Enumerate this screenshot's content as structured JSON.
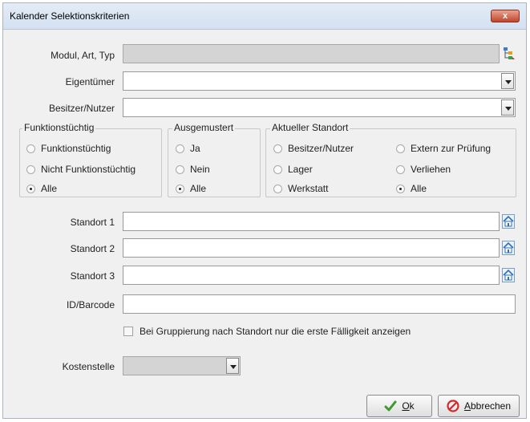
{
  "window": {
    "title": "Kalender Selektionskriterien",
    "close_glyph": "x"
  },
  "fields": {
    "modul_label": "Modul, Art, Typ",
    "eigentuemer_label": "Eigentümer",
    "besitzer_label": "Besitzer/Nutzer",
    "standort1_label": "Standort 1",
    "standort2_label": "Standort 2",
    "standort3_label": "Standort 3",
    "barcode_label": "ID/Barcode",
    "kostenstelle_label": "Kostenstelle"
  },
  "groups": {
    "funktion": {
      "title": "Funktionstüchtig",
      "options": [
        "Funktionstüchtig",
        "Nicht Funktionstüchtig",
        "Alle"
      ],
      "selected": "Alle"
    },
    "ausgemustert": {
      "title": "Ausgemustert",
      "options": [
        "Ja",
        "Nein",
        "Alle"
      ],
      "selected": "Alle"
    },
    "standort": {
      "title": "Aktueller Standort",
      "options": [
        "Besitzer/Nutzer",
        "Lager",
        "Werkstatt",
        "Extern zur Prüfung",
        "Verliehen",
        "Alle"
      ],
      "selected": "Alle"
    }
  },
  "checkbox": {
    "label": "Bei Gruppierung nach Standort nur die erste Fälligkeit anzeigen",
    "checked": false
  },
  "buttons": {
    "ok_underlined": "O",
    "ok_rest": "k",
    "cancel_underlined": "A",
    "cancel_rest": "bbrechen"
  },
  "icons": {
    "modul": "tree-select-icon",
    "standort": "house-icon",
    "ok": "checkmark-icon",
    "cancel": "cancel-icon",
    "dropdown": "chevron-down-icon"
  },
  "colors": {
    "title_bar": "#d4e1f1",
    "close_button": "#c0462c",
    "disabled_field": "#d4d4d4"
  }
}
